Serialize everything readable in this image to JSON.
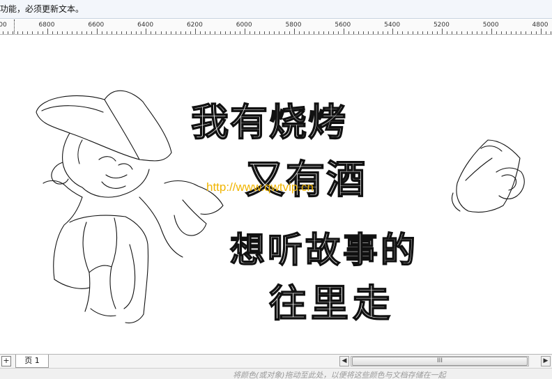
{
  "notice": {
    "text": "功能，必须更新文本。"
  },
  "ruler": {
    "labels": [
      "00",
      "6800",
      "6600",
      "6400",
      "6200",
      "6000",
      "5800",
      "5600",
      "5400",
      "5200",
      "5000",
      "4800"
    ]
  },
  "canvas": {
    "watermark": "http://www.qwtvip.cn",
    "poster_lines": [
      "我有烧烤",
      "又有酒",
      "想听故事的",
      "往里走"
    ]
  },
  "tabbar": {
    "add_page_icon": "+",
    "page_tab_label": "页 1",
    "scroll_left": "◀",
    "scroll_right": "▶",
    "thumb_grip": "III"
  },
  "status": {
    "hint": "将颜色(或对象)拖动至此处，以便将这些颜色与文档存储在一起"
  },
  "colors": {
    "watermark": "#f0b400",
    "ink": "#111111"
  }
}
